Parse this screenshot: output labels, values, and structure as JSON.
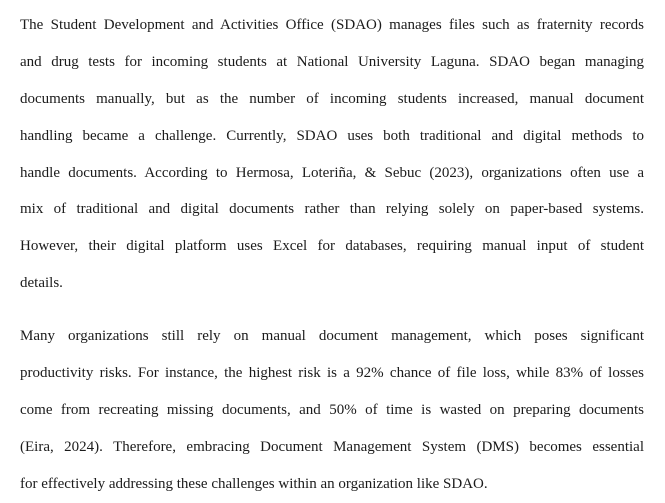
{
  "document": {
    "paragraphs": [
      {
        "lines": [
          "The Student Development and Activities Office (SDAO) manages files such as fraternity records",
          "and drug tests for incoming students at National University Laguna. SDAO began managing",
          "documents manually, but as the number of incoming students increased, manual document",
          "handling became a challenge. Currently, SDAO uses both traditional and digital methods to",
          "handle documents. According to Hermosa, Loteriña, & Sebuc (2023), organizations often use a",
          "mix of traditional and digital documents rather than relying solely on paper-based systems.",
          "However, their digital platform uses Excel for databases, requiring manual input of student",
          "details."
        ]
      },
      {
        "lines": [
          "Many organizations still rely on manual document management, which poses significant",
          "productivity risks. For instance, the highest risk is a 92% chance of file loss, while 83% of losses",
          "come from recreating missing documents, and 50% of time is wasted on preparing documents",
          "(Eira, 2024). Therefore, embracing Document Management System (DMS) becomes essential",
          "for effectively addressing these challenges within an organization like SDAO."
        ]
      }
    ]
  }
}
